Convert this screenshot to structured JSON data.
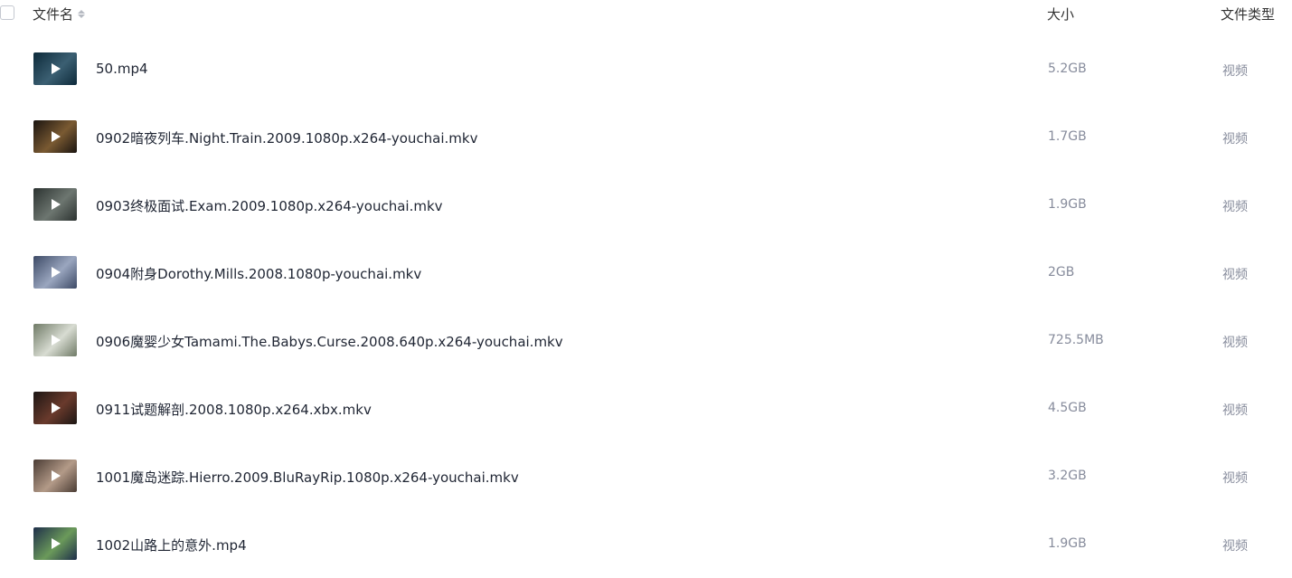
{
  "header": {
    "name_label": "文件名",
    "size_label": "大小",
    "type_label": "文件类型"
  },
  "files": [
    {
      "name": "50.mp4",
      "size": "5.2GB",
      "type": "视频",
      "thumb_colors": [
        "#0d2a3a",
        "#3b5f72"
      ]
    },
    {
      "name": "0902暗夜列车.Night.Train.2009.1080p.x264-youchai.mkv",
      "size": "1.7GB",
      "type": "视频",
      "thumb_colors": [
        "#1a1410",
        "#7a5a32"
      ]
    },
    {
      "name": "0903终极面试.Exam.2009.1080p.x264-youchai.mkv",
      "size": "1.9GB",
      "type": "视频",
      "thumb_colors": [
        "#2b3230",
        "#6d7670"
      ]
    },
    {
      "name": "0904附身Dorothy.Mills.2008.1080p-youchai.mkv",
      "size": "2GB",
      "type": "视频",
      "thumb_colors": [
        "#3d4a66",
        "#9aa6bf"
      ]
    },
    {
      "name": "0906魔婴少女Tamami.The.Babys.Curse.2008.640p.x264-youchai.mkv",
      "size": "725.5MB",
      "type": "视频",
      "thumb_colors": [
        "#6f7a66",
        "#d8dcd2"
      ]
    },
    {
      "name": "0911试题解剖.2008.1080p.x264.xbx.mkv",
      "size": "4.5GB",
      "type": "视频",
      "thumb_colors": [
        "#1c1614",
        "#6a3a2c"
      ]
    },
    {
      "name": "1001魔岛迷踪.Hierro.2009.BluRayRip.1080p.x264-youchai.mkv",
      "size": "3.2GB",
      "type": "视频",
      "thumb_colors": [
        "#4a3c34",
        "#b39a88"
      ]
    },
    {
      "name": "1002山路上的意外.mp4",
      "size": "1.9GB",
      "type": "视频",
      "thumb_colors": [
        "#1e2e4a",
        "#6b9a5a"
      ]
    }
  ]
}
